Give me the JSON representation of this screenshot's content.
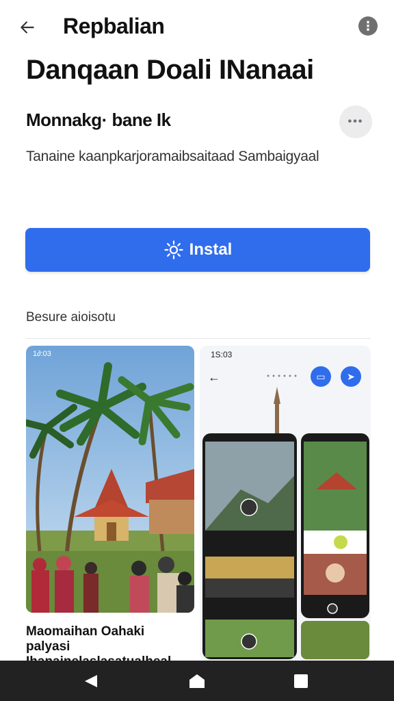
{
  "header": {
    "title": "Repbalian"
  },
  "app": {
    "name": "Danqaan Doali INanaai",
    "developer": "Monnakg· bane Ik",
    "subtitle": "Tanaine kaanpkarjoramaibsaitaad Sambaigyaal",
    "install_label": "Instal"
  },
  "screenshots": {
    "section_label": "Besure aioisotu",
    "first_caption": "Maomaihan Oahaki palyasi Ihanainelaslasatualheal",
    "status_time_1": "1∂:03",
    "status_time_2": "1S:03"
  },
  "icons": {
    "back": "back-arrow-icon",
    "more": "more-vert-icon",
    "install": "gear-icon",
    "nav_back": "nav-back-icon",
    "nav_home": "nav-home-icon",
    "nav_recent": "nav-recent-icon"
  },
  "colors": {
    "accent": "#2f6ded",
    "navbar": "#222222"
  }
}
